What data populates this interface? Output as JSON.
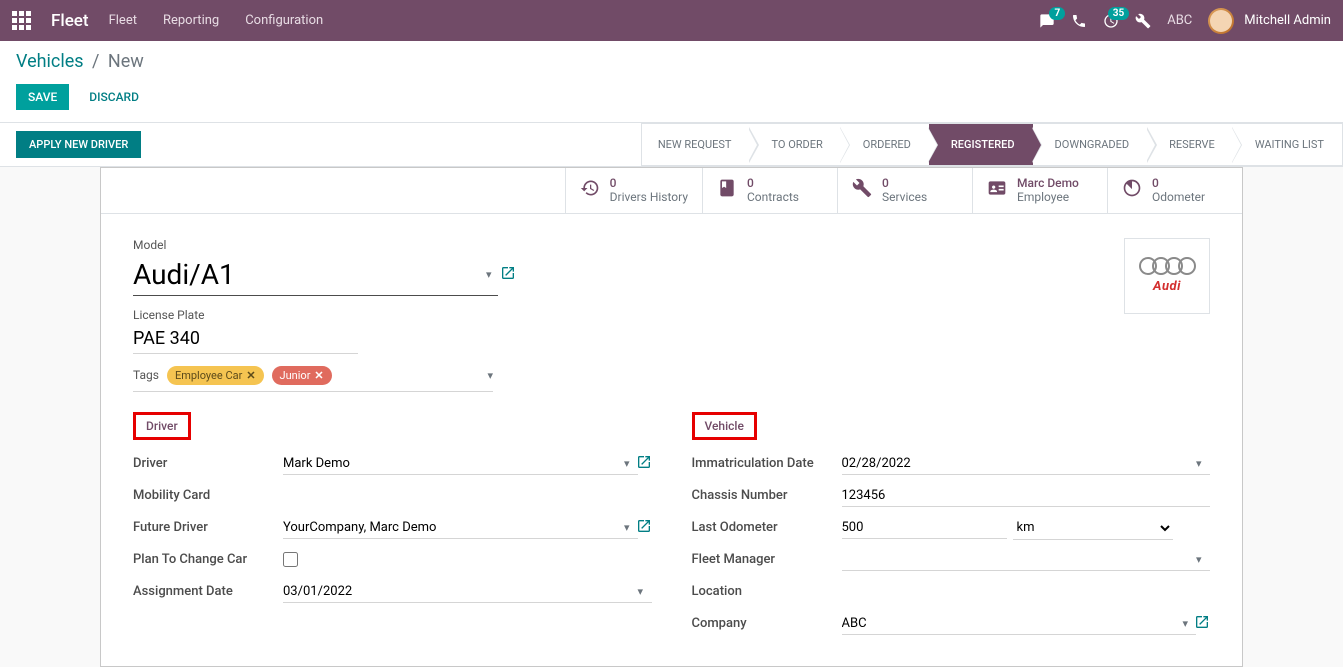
{
  "navbar": {
    "brand": "Fleet",
    "menu": [
      "Fleet",
      "Reporting",
      "Configuration"
    ],
    "messages_badge": "7",
    "activities_badge": "35",
    "company": "ABC",
    "user": "Mitchell Admin"
  },
  "breadcrumb": {
    "parent": "Vehicles",
    "current": "New"
  },
  "buttons": {
    "save": "SAVE",
    "discard": "DISCARD",
    "apply_driver": "APPLY NEW DRIVER"
  },
  "statusbar": [
    "NEW REQUEST",
    "TO ORDER",
    "ORDERED",
    "REGISTERED",
    "DOWNGRADED",
    "RESERVE",
    "WAITING LIST"
  ],
  "statusbar_active": "REGISTERED",
  "stat_buttons": {
    "drivers_history": {
      "value": "0",
      "label": "Drivers History"
    },
    "contracts": {
      "value": "0",
      "label": "Contracts"
    },
    "services": {
      "value": "0",
      "label": "Services"
    },
    "employee": {
      "value": "Marc Demo",
      "label": "Employee"
    },
    "odometer": {
      "value": "0",
      "label": "Odometer"
    }
  },
  "form": {
    "model_label": "Model",
    "model_value": "Audi/A1",
    "plate_label": "License Plate",
    "plate_value": "PAE 340",
    "tags_label": "Tags",
    "tags": [
      {
        "text": "Employee Car",
        "color": "yellow"
      },
      {
        "text": "Junior",
        "color": "red"
      }
    ],
    "brand_logo_text": "Audi"
  },
  "groups": {
    "driver": {
      "title": "Driver",
      "driver_label": "Driver",
      "driver_value": "Mark Demo",
      "mobility_label": "Mobility Card",
      "mobility_value": "",
      "future_driver_label": "Future Driver",
      "future_driver_value": "YourCompany, Marc Demo",
      "plan_change_label": "Plan To Change Car",
      "assignment_date_label": "Assignment Date",
      "assignment_date_value": "03/01/2022"
    },
    "vehicle": {
      "title": "Vehicle",
      "immat_label": "Immatriculation Date",
      "immat_value": "02/28/2022",
      "chassis_label": "Chassis Number",
      "chassis_value": "123456",
      "odometer_label": "Last Odometer",
      "odometer_value": "500",
      "odometer_unit": "km",
      "fleet_manager_label": "Fleet Manager",
      "fleet_manager_value": "",
      "location_label": "Location",
      "location_value": "",
      "company_label": "Company",
      "company_value": "ABC"
    }
  }
}
